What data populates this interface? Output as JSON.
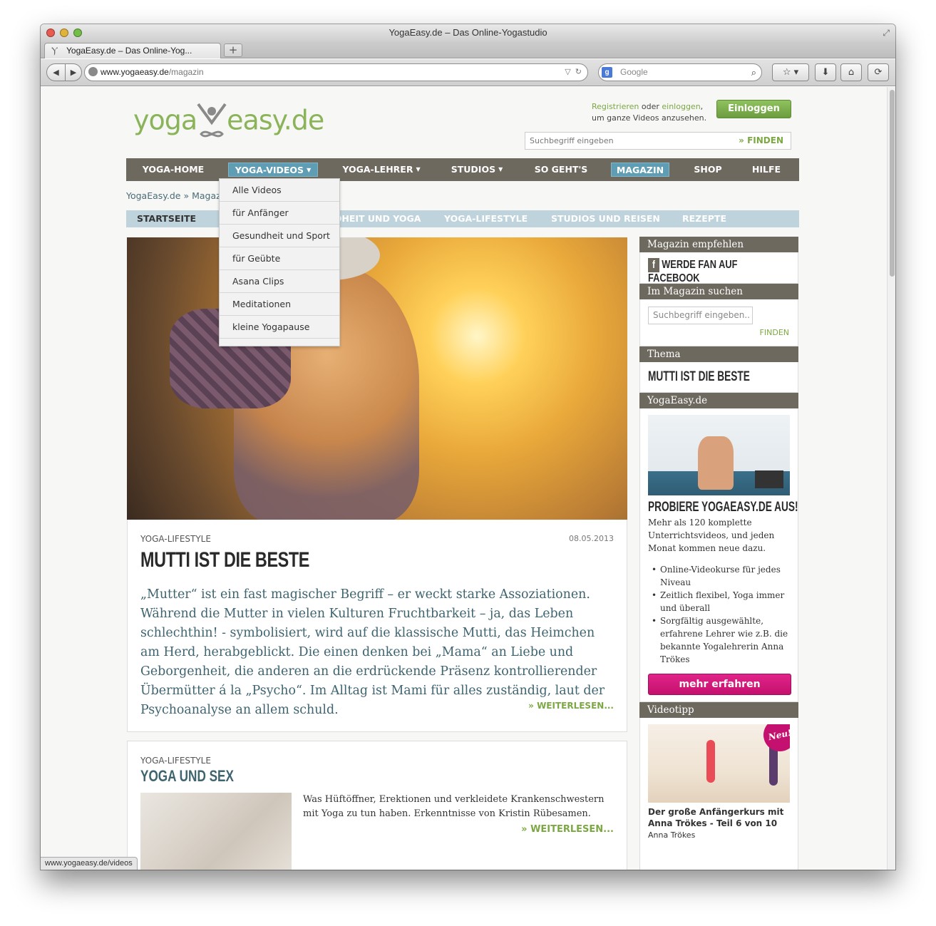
{
  "browser": {
    "window_title": "YogaEasy.de – Das Online-Yogastudio",
    "tab_title": "YogaEasy.de – Das Online-Yog...",
    "new_tab": "+",
    "url_host": "www.yogaeasy.de",
    "url_path": "/magazin",
    "search_engine_placeholder": "Google",
    "status_url": "www.yogaeasy.de/videos"
  },
  "header": {
    "logo_left": "yoga",
    "logo_right": "easy.de",
    "register_link": "Registrieren",
    "register_mid": " oder ",
    "login_link": "einloggen",
    "register_tail": ",",
    "register_line2": "um ganze Videos anzusehen.",
    "login_button": "Einloggen",
    "search_placeholder": "Suchbegriff eingeben",
    "search_button": "» FINDEN"
  },
  "mainnav": {
    "items": [
      "YOGA-HOME",
      "YOGA-VIDEOS",
      "YOGA-LEHRER",
      "STUDIOS",
      "SO GEHT'S",
      "MAGAZIN",
      "SHOP",
      "HILFE"
    ],
    "caret": "▼"
  },
  "breadcrumb": "YogaEasy.de » Magaz",
  "subnav": {
    "items": [
      "STARTSEITE",
      "DHEIT UND YOGA",
      "YOGA-LIFESTYLE",
      "STUDIOS UND REISEN",
      "REZEPTE"
    ]
  },
  "dropdown": {
    "items": [
      "Alle Videos",
      "für Anfänger",
      "Gesundheit und Sport",
      "für Geübte",
      "Asana Clips",
      "Meditationen",
      "kleine Yogapause"
    ]
  },
  "article": {
    "category": "YOGA-LIFESTYLE",
    "date": "08.05.2013",
    "title": "MUTTI IST DIE BESTE",
    "text": "„Mutter“ ist ein fast magischer Begriff – er weckt starke Assoziationen. Während die Mutter in vielen Kulturen Fruchtbarkeit – ja, das Leben schlechthin! - symbolisiert, wird auf die klassische Mutti, das Heimchen am Herd, herabgeblickt. Die einen denken bei „Mama“ an Liebe und Geborgenheit, die anderen an die erdrückende Präsenz kontrollierender Übermütter á la „Psycho“. Im Alltag ist Mami für alles zuständig, laut der Psychoanalyse an allem schuld.",
    "more": "» WEITERLESEN..."
  },
  "article2": {
    "category": "YOGA-LIFESTYLE",
    "title": "YOGA UND SEX",
    "text": "Was Hüftöffner, Erektionen und verkleidete Krankenschwestern mit Yoga zu tun haben. Erkenntnisse von Kristin Rübesamen.",
    "more": "» WEITERLESEN..."
  },
  "sidebar": {
    "recommend_head": "Magazin empfehlen",
    "facebook_icon": "f",
    "facebook": "WERDE FAN AUF FACEBOOK",
    "search_head": "Im Magazin suchen",
    "search_placeholder": "Suchbegriff eingeben..",
    "search_button": "FINDEN",
    "thema_head": "Thema",
    "thema_title": "MUTTI IST DIE BESTE",
    "yogaeasy_head": "YogaEasy.de",
    "yogaeasy_title": "PROBIERE YOGAEASY.DE AUS!",
    "yogaeasy_text": "Mehr als 120 komplette Unterrichtsvideos, und jeden Monat kommen neue dazu.",
    "yogaeasy_list": [
      "Online-Videokurse für jedes Niveau",
      "Zeitlich flexibel, Yoga immer und überall",
      "Sorgfältig ausgewählte, erfahrene Lehrer wie z.B. die bekannte Yogalehrerin Anna Trökes"
    ],
    "mehr_button": "mehr erfahren",
    "videotipp_head": "Videotipp",
    "neu_badge": "Neu!",
    "video_title": "Der große Anfängerkurs mit Anna Trökes - Teil 6 von 10",
    "video_author": "Anna Trökes"
  },
  "colors": {
    "nav_bg": "#6e695f",
    "nav_active": "#5f9db4",
    "green": "#7ca843",
    "pink": "#c4106e",
    "subnav_bg": "#bfd3dd"
  }
}
